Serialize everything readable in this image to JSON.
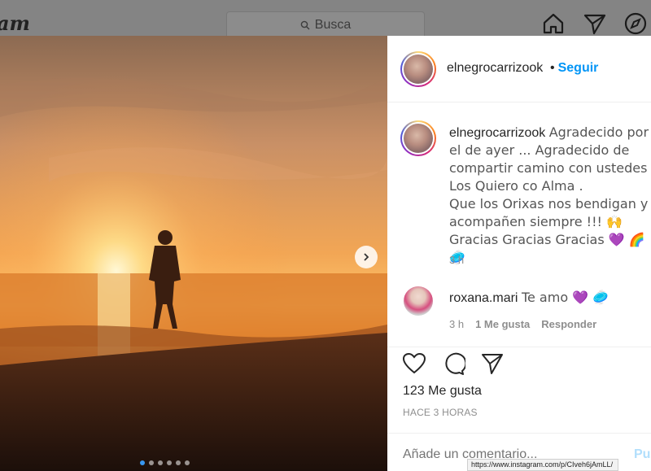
{
  "header": {
    "brand_fragment": "am",
    "search_placeholder": "Busca"
  },
  "post": {
    "username": "elnegrocarrizook",
    "bullet": "•",
    "follow_label": "Seguir",
    "caption_user": "elnegrocarrizook",
    "caption_text": "Agradecido por el de ayer ... Agradecido de compartir camino con ustedes . Los Quiero co Alma .\nQue los Orixas nos bendigan y acompañen siempre !!! 🙌 Gracias Gracias Gracias 💜 🌈 🥏",
    "caption_time": "3 h",
    "comments": [
      {
        "username": "roxana.mari",
        "text": "Te amo 💜 🥏",
        "time": "3 h",
        "likes": "1 Me gusta",
        "reply_label": "Responder"
      }
    ],
    "likes_count": "123 Me gusta",
    "posted_ago": "HACE 3 HORAS",
    "comment_placeholder": "Añade un comentario...",
    "publish_label": "Pul",
    "carousel_total": 6,
    "carousel_active": 0
  },
  "status_url": "https://www.instagram.com/p/CIveh6jAmLL/",
  "colors": {
    "accent": "#0095f6",
    "carousel_dot_active": "#3897f0"
  },
  "icons": [
    "search-icon",
    "home-icon",
    "paper-plane-icon",
    "compass-icon",
    "chevron-right-icon",
    "heart-icon",
    "comment-icon",
    "share-icon"
  ]
}
